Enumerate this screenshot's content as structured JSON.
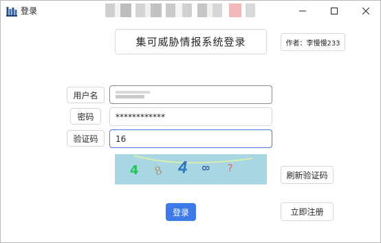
{
  "window": {
    "title": "登录",
    "controls": {
      "minimize": "minimize-icon",
      "maximize": "maximize-icon",
      "close": "close-icon"
    }
  },
  "header": {
    "title": "集可威胁情报系统登录",
    "author": "作者：李慢慢233"
  },
  "form": {
    "username": {
      "label": "用户名"
    },
    "password": {
      "label": "密码",
      "value": "************"
    },
    "captcha": {
      "label": "验证码",
      "value": "16"
    }
  },
  "captcha_image": {
    "characters": [
      "4",
      "8",
      "4",
      "8",
      "?"
    ],
    "colors": {
      "background": "#a8d6e2",
      "line": "#d8edb0",
      "char_1": "#22c45a",
      "char_2": "#a8946a",
      "char_3": "#2e86d8",
      "char_4": "#2b4d9a",
      "char_5": "#d06a5a"
    }
  },
  "buttons": {
    "refresh_captcha": "刷新验证码",
    "login": "登录",
    "register": "立即注册"
  },
  "colors": {
    "accent": "#3d7ae8",
    "focus_border": "#3d7ae8",
    "border": "#d6d6d6",
    "title_bar": "#ffffff"
  }
}
